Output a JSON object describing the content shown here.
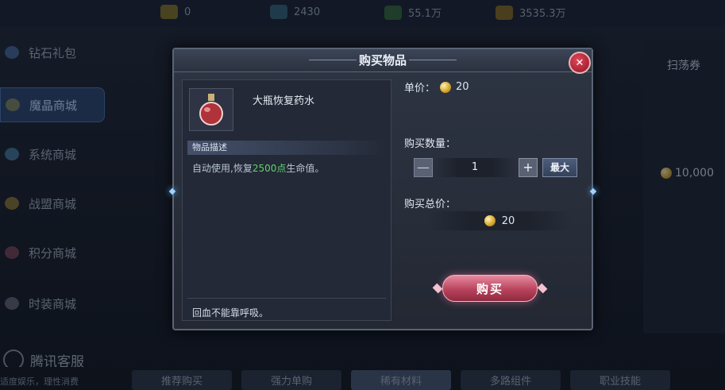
{
  "currencies": [
    {
      "icon": "gold-diamond-icon",
      "value": "0"
    },
    {
      "icon": "blue-diamond-icon",
      "value": "2430"
    },
    {
      "icon": "gem-stack-icon",
      "value": "55.1万"
    },
    {
      "icon": "gold-ingot-icon",
      "value": "3535.3万"
    }
  ],
  "sidebar": {
    "items": [
      {
        "label": "钻石礼包"
      },
      {
        "label": "魔晶商城"
      },
      {
        "label": "系统商城"
      },
      {
        "label": "战盟商城"
      },
      {
        "label": "积分商城"
      },
      {
        "label": "时装商城"
      }
    ]
  },
  "right_panel": {
    "title": "扫荡券",
    "price": "10,000"
  },
  "customer_service": "腾讯客服",
  "notice": "适度娱乐，理性消费",
  "bottom_tabs": [
    "推荐购买",
    "强力单购",
    "稀有材料",
    "多路组件",
    "职业技能"
  ],
  "dialog": {
    "title": "购买物品",
    "close_icon": "close-icon",
    "item": {
      "name": "大瓶恢复药水",
      "icon": "red-potion-flask-icon",
      "desc_header": "物品描述",
      "desc_prefix": "自动使用,恢复",
      "desc_highlight": "2500点",
      "desc_suffix": "生命值。",
      "note": "回血不能靠呼吸。"
    },
    "unit_price_label": "单价：",
    "unit_price": "20",
    "qty_label": "购买数量：",
    "quantity": "1",
    "minus_symbol": "—",
    "plus_symbol": "+",
    "max_label": "最大",
    "total_label": "购买总价：",
    "total_price": "20",
    "buy_label": "购买"
  },
  "colors": {
    "highlight_green": "#5fd36a",
    "buy_button": "#b8435c",
    "coin_gold": "#d8a832"
  }
}
